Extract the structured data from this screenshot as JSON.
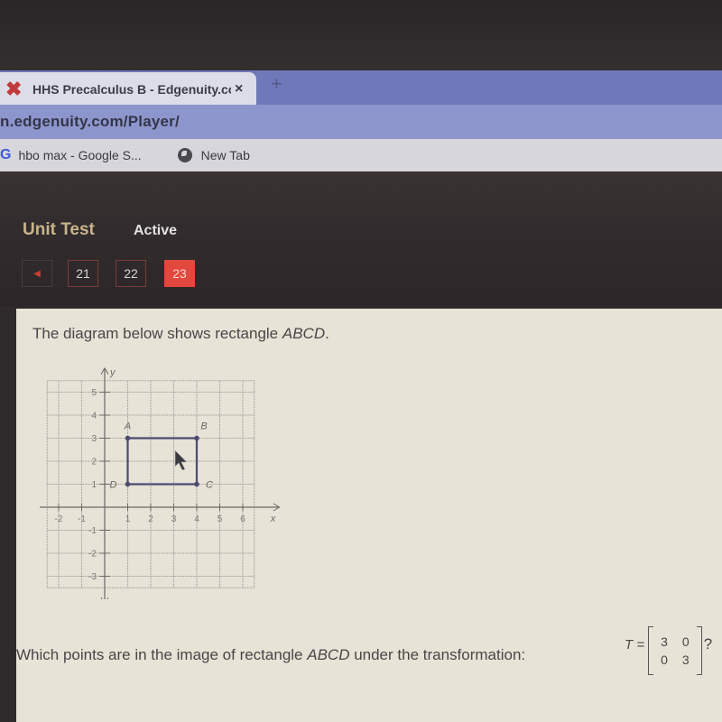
{
  "browser": {
    "tab_title": "HHS Precalculus B - Edgenuity.co",
    "tab_close": "×",
    "new_tab": "+",
    "url": "n.edgenuity.com/Player/",
    "bookmarks": [
      {
        "icon": "google-icon",
        "glyph": "G",
        "label": "hbo max - Google S..."
      },
      {
        "icon": "globe-icon",
        "glyph": "",
        "label": "New Tab"
      }
    ]
  },
  "header": {
    "section": "Unit Test",
    "status": "Active",
    "prev_glyph": "◀",
    "questions": [
      {
        "label": "21",
        "active": false
      },
      {
        "label": "22",
        "active": false
      },
      {
        "label": "23",
        "active": true
      }
    ]
  },
  "question": {
    "intro_prefix": "The diagram below shows rectangle ",
    "intro_shape": "ABCD",
    "intro_suffix": ".",
    "prompt_prefix": "Which points are in the image of rectangle ",
    "prompt_shape": "ABCD",
    "prompt_suffix": " under the transformation: ",
    "matrix_name": "T =",
    "matrix": [
      [
        "3",
        "0"
      ],
      [
        "0",
        "3"
      ]
    ],
    "question_mark": "?"
  },
  "colors": {
    "accent_red": "#e2483d",
    "rectangle_stroke": "#4d4a72",
    "header_label": "#c9b48a"
  },
  "chart_data": {
    "type": "scatter",
    "title": "",
    "xlabel": "x",
    "ylabel": "y",
    "xlim": [
      -2,
      6
    ],
    "ylim": [
      -3,
      5
    ],
    "x_ticks": [
      -2,
      -1,
      1,
      2,
      3,
      4,
      5,
      6
    ],
    "y_ticks": [
      -3,
      -2,
      -1,
      1,
      2,
      3,
      4,
      5
    ],
    "grid": true,
    "points": [
      {
        "label": "A",
        "x": 1,
        "y": 3
      },
      {
        "label": "B",
        "x": 4,
        "y": 3
      },
      {
        "label": "C",
        "x": 4,
        "y": 1
      },
      {
        "label": "D",
        "x": 1,
        "y": 1
      }
    ],
    "polygon": [
      "A",
      "B",
      "C",
      "D"
    ]
  }
}
